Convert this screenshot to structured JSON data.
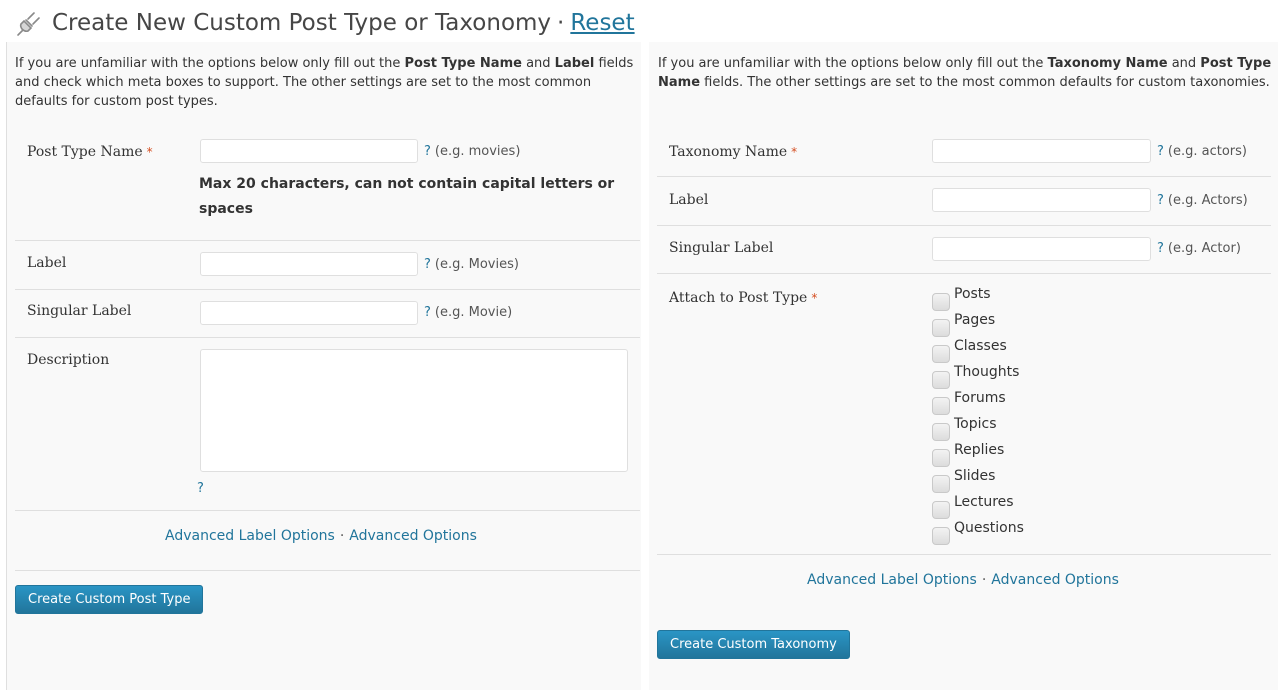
{
  "header": {
    "title": "Create New Custom Post Type or Taxonomy",
    "separator": "·",
    "reset_link": "Reset",
    "icon": "plug-icon"
  },
  "post_type": {
    "intro_1": "If you are unfamiliar with the options below only fill out the ",
    "intro_b1": "Post Type Name",
    "intro_2": " and ",
    "intro_b2": "Label",
    "intro_3": " fields and check which meta boxes to support. The other settings are set to the most common defaults for custom post types.",
    "fields": {
      "name": {
        "label": "Post Type Name",
        "required": "*",
        "value": "",
        "hint_q": "?",
        "hint": "(e.g. movies)"
      },
      "note": "Max 20 characters, can not contain capital letters or spaces",
      "label": {
        "label": "Label",
        "value": "",
        "hint_q": "?",
        "hint": "(e.g. Movies)"
      },
      "singular": {
        "label": "Singular Label",
        "value": "",
        "hint_q": "?",
        "hint": "(e.g. Movie)"
      },
      "description": {
        "label": "Description",
        "value": "",
        "hint_q": "?"
      }
    },
    "advanced_label": "Advanced Label Options",
    "advanced_sep": "·",
    "advanced_options": "Advanced Options",
    "submit": "Create Custom Post Type"
  },
  "taxonomy": {
    "intro_1": "If you are unfamiliar with the options below only fill out the ",
    "intro_b1": "Taxonomy Name",
    "intro_2": " and ",
    "intro_b2": "Post Type Name",
    "intro_3": " fields. The other settings are set to the most common defaults for custom taxonomies.",
    "fields": {
      "name": {
        "label": "Taxonomy Name",
        "required": "*",
        "value": "",
        "hint_q": "?",
        "hint": "(e.g. actors)"
      },
      "label": {
        "label": "Label",
        "value": "",
        "hint_q": "?",
        "hint": "(e.g. Actors)"
      },
      "singular": {
        "label": "Singular Label",
        "value": "",
        "hint_q": "?",
        "hint": "(e.g. Actor)"
      },
      "attach": {
        "label": "Attach to Post Type",
        "required": "*"
      }
    },
    "post_types": [
      "Posts",
      "Pages",
      "Classes",
      "Thoughts",
      "Forums",
      "Topics",
      "Replies",
      "Slides",
      "Lectures",
      "Questions"
    ],
    "advanced_label": "Advanced Label Options",
    "advanced_sep": "·",
    "advanced_options": "Advanced Options",
    "submit": "Create Custom Taxonomy"
  },
  "colors": {
    "link": "#21759b",
    "required": "#d54e21",
    "panel_bg": "#f9f9f9",
    "button_bg": "#21759b"
  }
}
